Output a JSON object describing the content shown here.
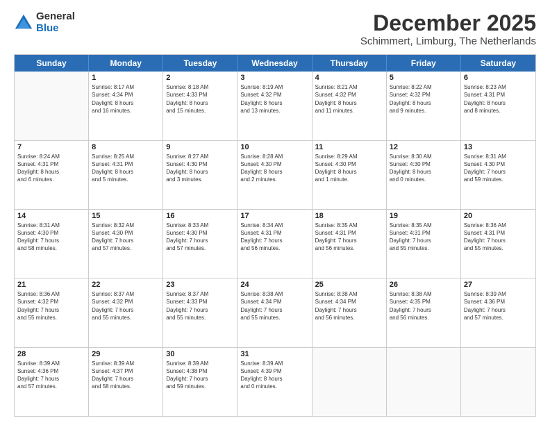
{
  "logo": {
    "general": "General",
    "blue": "Blue"
  },
  "title": "December 2025",
  "subtitle": "Schimmert, Limburg, The Netherlands",
  "calendar": {
    "headers": [
      "Sunday",
      "Monday",
      "Tuesday",
      "Wednesday",
      "Thursday",
      "Friday",
      "Saturday"
    ],
    "weeks": [
      [
        {
          "day": "",
          "info": ""
        },
        {
          "day": "1",
          "info": "Sunrise: 8:17 AM\nSunset: 4:34 PM\nDaylight: 8 hours\nand 16 minutes."
        },
        {
          "day": "2",
          "info": "Sunrise: 8:18 AM\nSunset: 4:33 PM\nDaylight: 8 hours\nand 15 minutes."
        },
        {
          "day": "3",
          "info": "Sunrise: 8:19 AM\nSunset: 4:32 PM\nDaylight: 8 hours\nand 13 minutes."
        },
        {
          "day": "4",
          "info": "Sunrise: 8:21 AM\nSunset: 4:32 PM\nDaylight: 8 hours\nand 11 minutes."
        },
        {
          "day": "5",
          "info": "Sunrise: 8:22 AM\nSunset: 4:32 PM\nDaylight: 8 hours\nand 9 minutes."
        },
        {
          "day": "6",
          "info": "Sunrise: 8:23 AM\nSunset: 4:31 PM\nDaylight: 8 hours\nand 8 minutes."
        }
      ],
      [
        {
          "day": "7",
          "info": "Sunrise: 8:24 AM\nSunset: 4:31 PM\nDaylight: 8 hours\nand 6 minutes."
        },
        {
          "day": "8",
          "info": "Sunrise: 8:25 AM\nSunset: 4:31 PM\nDaylight: 8 hours\nand 5 minutes."
        },
        {
          "day": "9",
          "info": "Sunrise: 8:27 AM\nSunset: 4:30 PM\nDaylight: 8 hours\nand 3 minutes."
        },
        {
          "day": "10",
          "info": "Sunrise: 8:28 AM\nSunset: 4:30 PM\nDaylight: 8 hours\nand 2 minutes."
        },
        {
          "day": "11",
          "info": "Sunrise: 8:29 AM\nSunset: 4:30 PM\nDaylight: 8 hours\nand 1 minute."
        },
        {
          "day": "12",
          "info": "Sunrise: 8:30 AM\nSunset: 4:30 PM\nDaylight: 8 hours\nand 0 minutes."
        },
        {
          "day": "13",
          "info": "Sunrise: 8:31 AM\nSunset: 4:30 PM\nDaylight: 7 hours\nand 59 minutes."
        }
      ],
      [
        {
          "day": "14",
          "info": "Sunrise: 8:31 AM\nSunset: 4:30 PM\nDaylight: 7 hours\nand 58 minutes."
        },
        {
          "day": "15",
          "info": "Sunrise: 8:32 AM\nSunset: 4:30 PM\nDaylight: 7 hours\nand 57 minutes."
        },
        {
          "day": "16",
          "info": "Sunrise: 8:33 AM\nSunset: 4:30 PM\nDaylight: 7 hours\nand 57 minutes."
        },
        {
          "day": "17",
          "info": "Sunrise: 8:34 AM\nSunset: 4:31 PM\nDaylight: 7 hours\nand 56 minutes."
        },
        {
          "day": "18",
          "info": "Sunrise: 8:35 AM\nSunset: 4:31 PM\nDaylight: 7 hours\nand 56 minutes."
        },
        {
          "day": "19",
          "info": "Sunrise: 8:35 AM\nSunset: 4:31 PM\nDaylight: 7 hours\nand 55 minutes."
        },
        {
          "day": "20",
          "info": "Sunrise: 8:36 AM\nSunset: 4:31 PM\nDaylight: 7 hours\nand 55 minutes."
        }
      ],
      [
        {
          "day": "21",
          "info": "Sunrise: 8:36 AM\nSunset: 4:32 PM\nDaylight: 7 hours\nand 55 minutes."
        },
        {
          "day": "22",
          "info": "Sunrise: 8:37 AM\nSunset: 4:32 PM\nDaylight: 7 hours\nand 55 minutes."
        },
        {
          "day": "23",
          "info": "Sunrise: 8:37 AM\nSunset: 4:33 PM\nDaylight: 7 hours\nand 55 minutes."
        },
        {
          "day": "24",
          "info": "Sunrise: 8:38 AM\nSunset: 4:34 PM\nDaylight: 7 hours\nand 55 minutes."
        },
        {
          "day": "25",
          "info": "Sunrise: 8:38 AM\nSunset: 4:34 PM\nDaylight: 7 hours\nand 56 minutes."
        },
        {
          "day": "26",
          "info": "Sunrise: 8:38 AM\nSunset: 4:35 PM\nDaylight: 7 hours\nand 56 minutes."
        },
        {
          "day": "27",
          "info": "Sunrise: 8:39 AM\nSunset: 4:36 PM\nDaylight: 7 hours\nand 57 minutes."
        }
      ],
      [
        {
          "day": "28",
          "info": "Sunrise: 8:39 AM\nSunset: 4:36 PM\nDaylight: 7 hours\nand 57 minutes."
        },
        {
          "day": "29",
          "info": "Sunrise: 8:39 AM\nSunset: 4:37 PM\nDaylight: 7 hours\nand 58 minutes."
        },
        {
          "day": "30",
          "info": "Sunrise: 8:39 AM\nSunset: 4:38 PM\nDaylight: 7 hours\nand 59 minutes."
        },
        {
          "day": "31",
          "info": "Sunrise: 8:39 AM\nSunset: 4:39 PM\nDaylight: 8 hours\nand 0 minutes."
        },
        {
          "day": "",
          "info": ""
        },
        {
          "day": "",
          "info": ""
        },
        {
          "day": "",
          "info": ""
        }
      ]
    ]
  }
}
